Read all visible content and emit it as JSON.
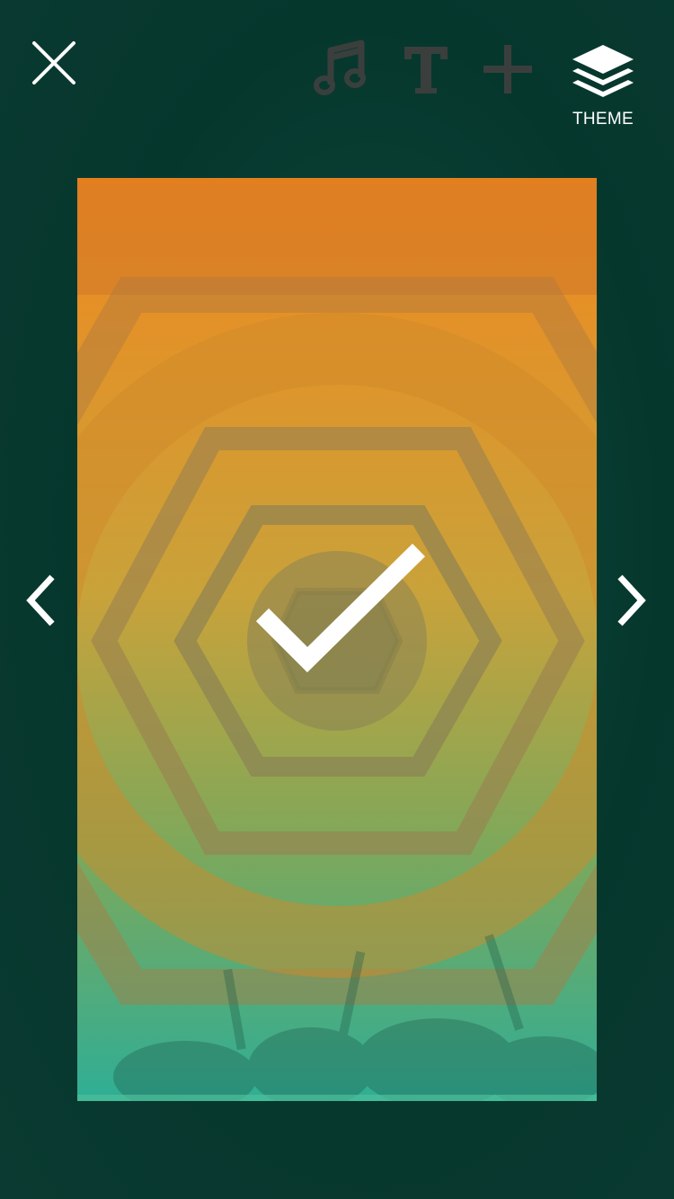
{
  "toolbar": {
    "close_icon": "close-icon",
    "music_icon": "music-note-icon",
    "text_icon": "text-icon",
    "add_icon": "plus-icon",
    "theme_icon": "layers-icon",
    "theme_label": "THEME"
  },
  "preview": {
    "selected_icon": "checkmark-icon",
    "gradient_top": "#f0891e",
    "gradient_mid": "#c9a23a",
    "gradient_bottom": "#2fae95"
  },
  "nav": {
    "prev_icon": "chevron-left-icon",
    "next_icon": "chevron-right-icon"
  },
  "colors": {
    "background": "#06372d",
    "icon_inactive": "#3a3f3d",
    "icon_active": "#ffffff"
  }
}
